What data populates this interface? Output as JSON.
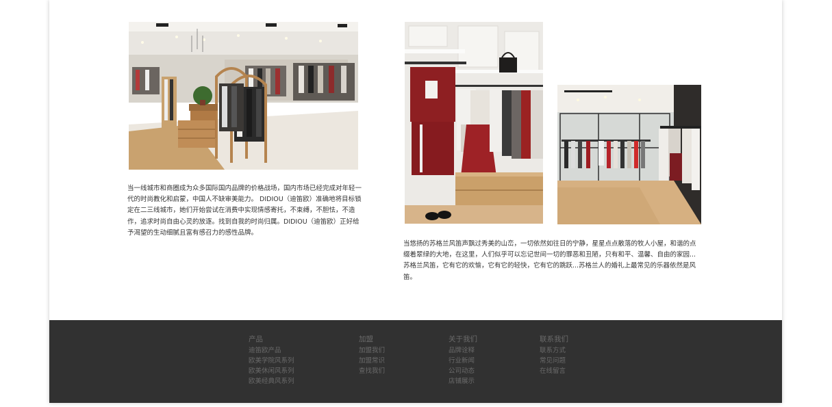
{
  "content": {
    "photos": [
      {
        "alt": "store-interior"
      },
      {
        "alt": "clothing-rack"
      },
      {
        "alt": "store-corner"
      }
    ],
    "left_paragraph": "当一线城市和商圈成为众多国际国内品牌的价格战场，国内市场已经完成对年轻一代的时尚教化和启蒙，中国人不缺审美能力。 DIDIOU（迪笛欧）准确地将目标锁定在二三线城市，她们开始尝试在消费中实现情感寄托，不束缚，不胆怯，不造作，追求时尚自由心灵的放逐。找到自我的时尚归属。DIDIOU（迪笛欧）正好给予渴望的生动细腻且富有感召力的感性品牌。",
    "right_paragraph": "当悠扬的苏格兰风笛声飘过秀美的山峦，一切依然如往日的宁静，星星点点散落的牧人小屋，和谐的点缀着翠绿的大地，在这里，人们似乎可以忘记世间一切的罪恶和丑陋，只有和平、温馨、自由的家园...苏格兰风笛，它有它的欢愉，它有它的轻快，它有它的跳跃...苏格兰人的婚礼上最常见的乐器依然是风笛。"
  },
  "footer": {
    "columns": [
      {
        "title": "产品",
        "links": [
          "迪笛欧产品",
          "欧美学院风系列",
          "欧美休闲风系列",
          "欧美经典风系列"
        ]
      },
      {
        "title": "加盟",
        "links": [
          "加盟我们",
          "加盟常识",
          "查找我们"
        ]
      },
      {
        "title": "关于我们",
        "links": [
          "品牌诠释",
          "行业新闻",
          "公司动态",
          "店铺展示"
        ]
      },
      {
        "title": "联系我们",
        "links": [
          "联系方式",
          "常见问题",
          "在线留言"
        ]
      }
    ]
  },
  "colors": {
    "footer_bg": "#313131",
    "footer_text": "#6a6a6a",
    "body_text": "#333333"
  }
}
